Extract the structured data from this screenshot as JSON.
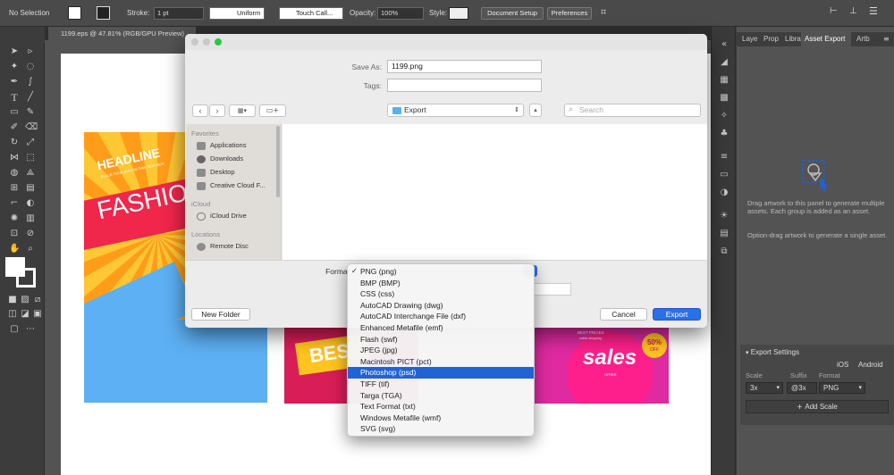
{
  "control_bar": {
    "selection": "No Selection",
    "stroke_label": "Stroke:",
    "stroke_value": "1 pt",
    "profile": "Uniform",
    "brush": "Touch Call...",
    "opacity_label": "Opacity:",
    "opacity_value": "100%",
    "style_label": "Style:",
    "document_setup": "Document Setup",
    "preferences": "Preferences"
  },
  "document_tab": {
    "title": "1199.eps @ 47.81% (RGB/GPU Preview)"
  },
  "artwork": {
    "headline": "HEADLINE",
    "subhead": "PLACE YOUR INFO IN THIS TEXT BOX",
    "fashion": "FASHIO",
    "best": "BES",
    "sales": "sales",
    "offer": "OFFER",
    "best_prices": "BEST PRICES",
    "online_shopping": "online shopping",
    "badge": "50%",
    "badge_off": "OFF"
  },
  "save_dialog": {
    "save_as_label": "Save As:",
    "save_as_value": "1199.png",
    "tags_label": "Tags:",
    "location": "Export",
    "search_placeholder": "Search",
    "sidebar": {
      "favorites_header": "Favorites",
      "favorites": [
        "Applications",
        "Downloads",
        "Desktop",
        "Creative Cloud F..."
      ],
      "icloud_header": "iCloud",
      "icloud": [
        "iCloud Drive"
      ],
      "locations_header": "Locations",
      "locations": [
        "Remote Disc"
      ]
    },
    "format_label": "Format",
    "new_folder": "New Folder",
    "cancel": "Cancel",
    "export": "Export"
  },
  "format_menu": {
    "options": [
      "PNG (png)",
      "BMP (BMP)",
      "CSS (css)",
      "AutoCAD Drawing (dwg)",
      "AutoCAD Interchange File (dxf)",
      "Enhanced Metafile (emf)",
      "Flash (swf)",
      "JPEG (jpg)",
      "Macintosh PICT (pct)",
      "Photoshop (psd)",
      "TIFF (tif)",
      "Targa (TGA)",
      "Text Format (txt)",
      "Windows Metafile (wmf)",
      "SVG (svg)"
    ],
    "checked": "PNG (png)",
    "highlighted": "Photoshop (psd)"
  },
  "panel": {
    "tabs": [
      "Laye",
      "Prop",
      "Libra",
      "Asset Export",
      "Artb"
    ],
    "active_tab": "Asset Export",
    "hint1": "Drag artwork to this panel to generate multiple assets. Each group is added as an asset.",
    "hint2": "Option-drag artwork to generate a single asset.",
    "export_settings": "Export Settings",
    "ios": "iOS",
    "android": "Android",
    "col_scale": "Scale",
    "col_suffix": "Suffix",
    "col_format": "Format",
    "scale_value": "3x",
    "suffix_value": "@3x",
    "format_value": "PNG",
    "add_scale": "Add Scale"
  },
  "colors": {
    "accent": "#1f63d4",
    "chrome_dark": "#3c3c3c",
    "panel": "#535353",
    "dialog_bg": "#ececec"
  }
}
